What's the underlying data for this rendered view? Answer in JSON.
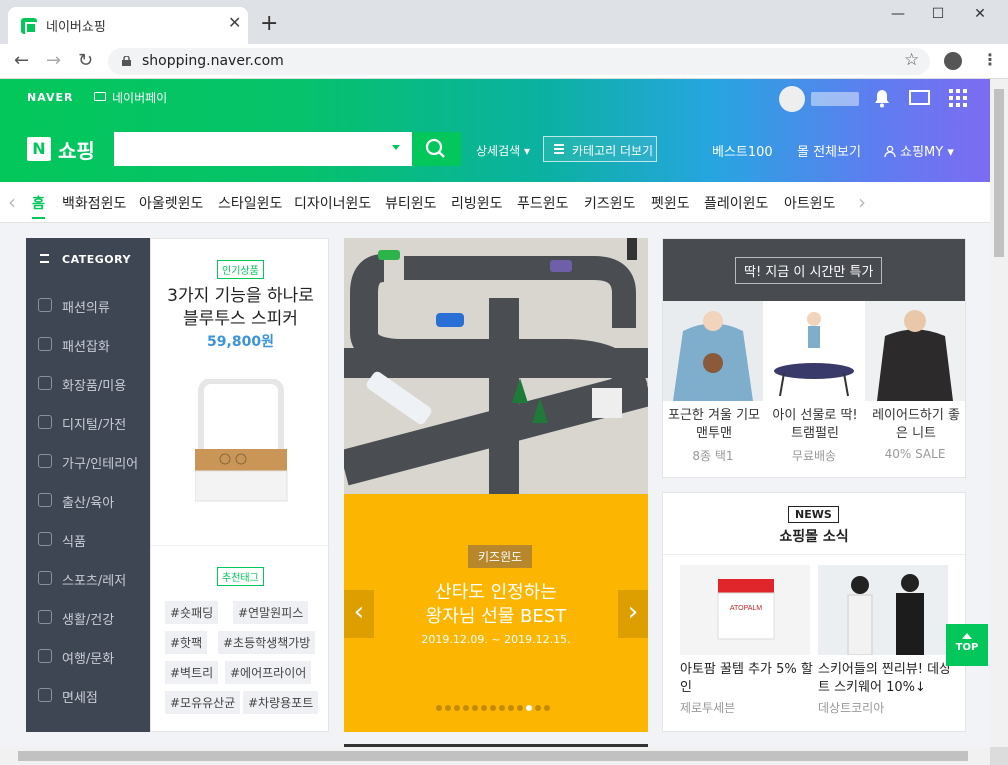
{
  "browser": {
    "tab_title": "네이버쇼핑",
    "tab_close": "✕",
    "new_tab": "+",
    "url": "shopping.naver.com",
    "window_controls": {
      "minimize": "—",
      "maximize": "☐",
      "close": "✕"
    },
    "nav": {
      "back": "←",
      "forward": "→",
      "reload": "↻",
      "star": "☆",
      "menu": "⋮"
    }
  },
  "header": {
    "naver_label": "NAVER",
    "naverpay_label": "네이버페이",
    "shop_logo_letter": "N",
    "shop_logo_text": "쇼핑",
    "detail_search": "상세검색 ▾",
    "category_more": "카테고리 더보기",
    "links": [
      "베스트100",
      "몰 전체보기",
      "쇼핑MY ▾"
    ]
  },
  "category_nav": {
    "prev": "‹",
    "next": "›",
    "items": [
      "홈",
      "백화점윈도",
      "아울렛윈도",
      "스타일윈도",
      "디자이너윈도",
      "뷰티윈도",
      "리빙윈도",
      "푸드윈도",
      "키즈윈도",
      "펫윈도",
      "플레이윈도",
      "아트윈도"
    ]
  },
  "sidebar": {
    "header": "CATEGORY",
    "items": [
      "패션의류",
      "패션잡화",
      "화장품/미용",
      "디지털/가전",
      "가구/인테리어",
      "출산/육아",
      "식품",
      "스포츠/레저",
      "생활/건강",
      "여행/문화",
      "면세점"
    ]
  },
  "product": {
    "badge": "인기상품",
    "title_line1": "3가지 기능을 하나로",
    "title_line2": "블루투스 스피커",
    "price": "59,800원",
    "tag_badge": "추천태그",
    "hashtags": [
      "#숏패딩",
      "#연말원피스",
      "#핫팩",
      "#초등학생책가방",
      "#벽트리",
      "#에어프라이어",
      "#모유유산균",
      "#차량용포트"
    ]
  },
  "banner": {
    "badge": "키즈윈도",
    "title_line1": "산타도 인정하는",
    "title_line2": "왕자님 선물 BEST",
    "date": "2019.12.09. ~ 2019.12.15.",
    "prev": "‹",
    "next": "›",
    "dot_count": 13,
    "active_dot": 10
  },
  "timedeal": {
    "title": "딱! 지금 이 시간만 특가",
    "items": [
      {
        "name": "포근한 겨울 기모 맨투맨",
        "sub": "8종 택1"
      },
      {
        "name": "아이 선물로 딱! 트램펄린",
        "sub": "무료배송"
      },
      {
        "name": "레이어드하기 좋은 니트",
        "sub": "40% SALE"
      }
    ]
  },
  "news": {
    "badge": "NEWS",
    "title": "쇼핑몰 소식",
    "items": [
      {
        "text": "아토팜 꿀템 추가 5% 할인",
        "source": "제로투세븐",
        "image_label": "ATOPALM"
      },
      {
        "text": "스키어들의 찐리뷰! 데상트 스키웨어 10%↓",
        "source": "데상트코리아"
      }
    ]
  },
  "top_button": "TOP",
  "colors": {
    "brand": "#03c75a",
    "price": "#3b94d9",
    "sidebar": "#3e4553",
    "banner": "#fcb500"
  }
}
